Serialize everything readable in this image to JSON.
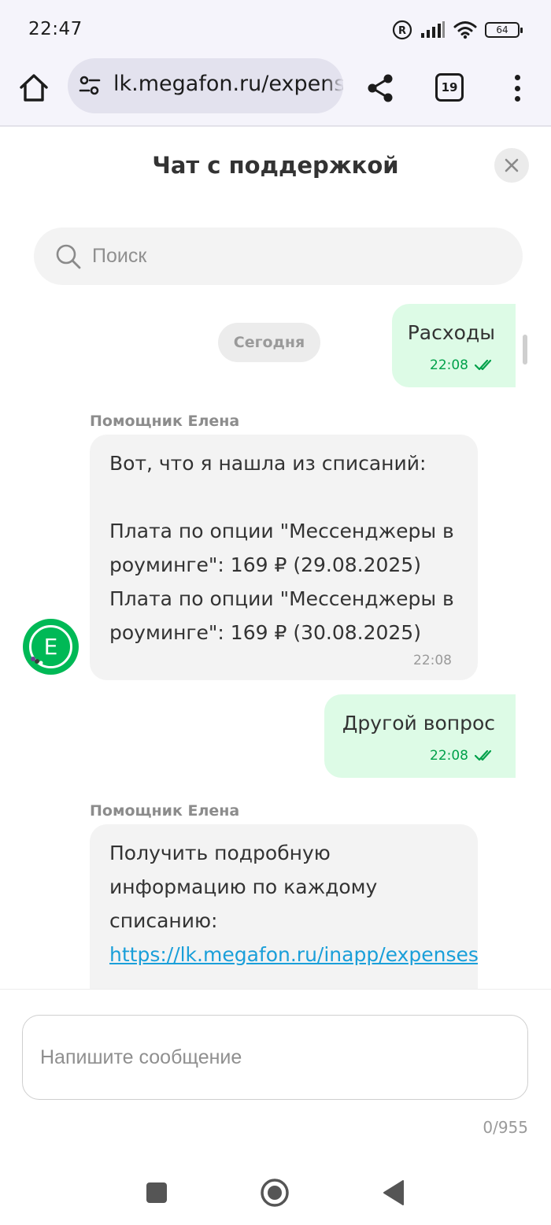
{
  "status_bar": {
    "time": "22:47",
    "battery": "64"
  },
  "browser": {
    "url": "lk.megafon.ru/expenses",
    "tab_count": "19"
  },
  "chat": {
    "title": "Чат с поддержкой",
    "search_placeholder": "Поиск",
    "day_label": "Сегодня",
    "messages": [
      {
        "direction": "out",
        "text": "Расходы",
        "time": "22:08"
      },
      {
        "direction": "in",
        "sender": "Помощник Елена",
        "text": "Вот, что я нашла из списаний:\n\nПлата по опции \"Мессенджеры в роуминге\": 169 ₽ (29.08.2025)\nПлата по опции \"Мессенджеры в роуминге\": 169 ₽ (30.08.2025)",
        "time": "22:08"
      },
      {
        "direction": "out",
        "text": "Другой вопрос",
        "time": "22:08"
      },
      {
        "direction": "in",
        "sender": "Помощник Елена",
        "text": "Получить подробную информацию по каждому списанию:",
        "link": "https://lk.megafon.ru/inapp/expenses"
      }
    ],
    "avatar_letter": "Е"
  },
  "composer": {
    "placeholder": "Напишите сообщение",
    "counter": "0/955"
  },
  "colors": {
    "accent_green": "#00b956",
    "outgoing_bubble": "#ddfbe6",
    "incoming_bubble": "#f3f3f3",
    "link": "#1a9fd9"
  },
  "icons": {
    "home": "home-icon",
    "site_settings": "tune-icon",
    "share": "share-icon",
    "more": "more-vert-icon",
    "close": "close-icon",
    "search": "search-icon",
    "read": "double-check-icon",
    "nav_recents": "square-icon",
    "nav_home": "circle-icon",
    "nav_back": "triangle-back-icon"
  }
}
